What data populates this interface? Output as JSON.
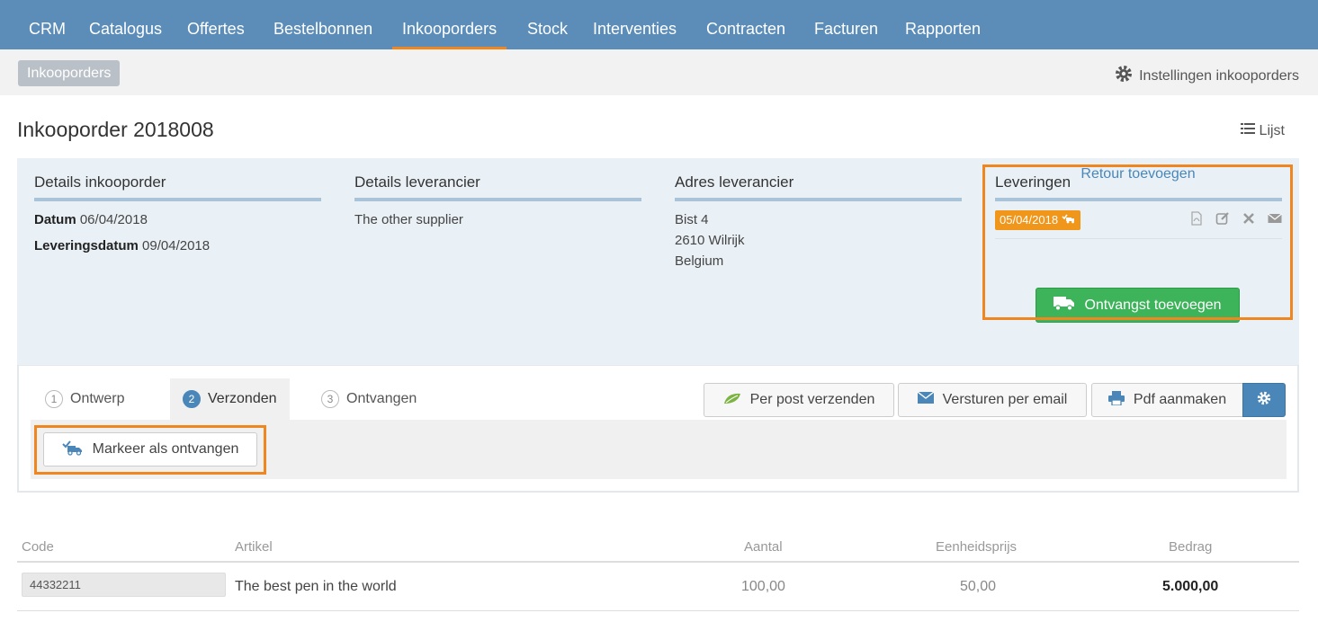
{
  "nav": {
    "items": [
      {
        "label": "CRM"
      },
      {
        "label": "Catalogus"
      },
      {
        "label": "Offertes"
      },
      {
        "label": "Bestelbonnen"
      },
      {
        "label": "Inkooporders",
        "active": true
      },
      {
        "label": "Stock"
      },
      {
        "label": "Interventies"
      },
      {
        "label": "Contracten"
      },
      {
        "label": "Facturen"
      },
      {
        "label": "Rapporten"
      }
    ]
  },
  "subbar": {
    "breadcrumb": "Inkooporders",
    "settings_label": "Instellingen inkooporders",
    "settings_icon": "gear-icon"
  },
  "page": {
    "title": "Inkooporder 2018008",
    "list_label": "Lijst",
    "list_icon": "list-icon"
  },
  "details": {
    "heading": "Details inkooporder",
    "date_label": "Datum",
    "date_value": "06/04/2018",
    "delivery_label": "Leveringsdatum",
    "delivery_value": "09/04/2018"
  },
  "supplier": {
    "heading": "Details leverancier",
    "name": "The other supplier"
  },
  "address": {
    "heading": "Adres leverancier",
    "street": "Bist 4",
    "city": "2610 Wilrijk",
    "country": "Belgium"
  },
  "deliveries": {
    "heading": "Leveringen",
    "items": [
      {
        "date": "05/04/2018"
      }
    ],
    "add_receipt_label": "Ontvangst toevoegen",
    "add_return_label": "Retour toevoegen"
  },
  "workflow": {
    "tabs": [
      {
        "num": "1",
        "label": "Ontwerp"
      },
      {
        "num": "2",
        "label": "Verzonden",
        "active": true
      },
      {
        "num": "3",
        "label": "Ontvangen"
      }
    ],
    "mark_received_label": "Markeer als ontvangen",
    "post_label": "Per post verzenden",
    "email_label": "Versturen per email",
    "pdf_label": "Pdf aanmaken"
  },
  "table": {
    "columns": {
      "code": "Code",
      "article": "Artikel",
      "qty": "Aantal",
      "unit_price": "Eenheidsprijs",
      "amount": "Bedrag"
    },
    "rows": [
      {
        "code": "44332211",
        "article": "The best pen in the world",
        "qty": "100,00",
        "unit_price": "50,00",
        "amount": "5.000,00"
      }
    ]
  },
  "colors": {
    "nav": "#5b8db8",
    "accent": "#f0861f",
    "green": "#3db35a",
    "blue": "#4a86b8"
  }
}
